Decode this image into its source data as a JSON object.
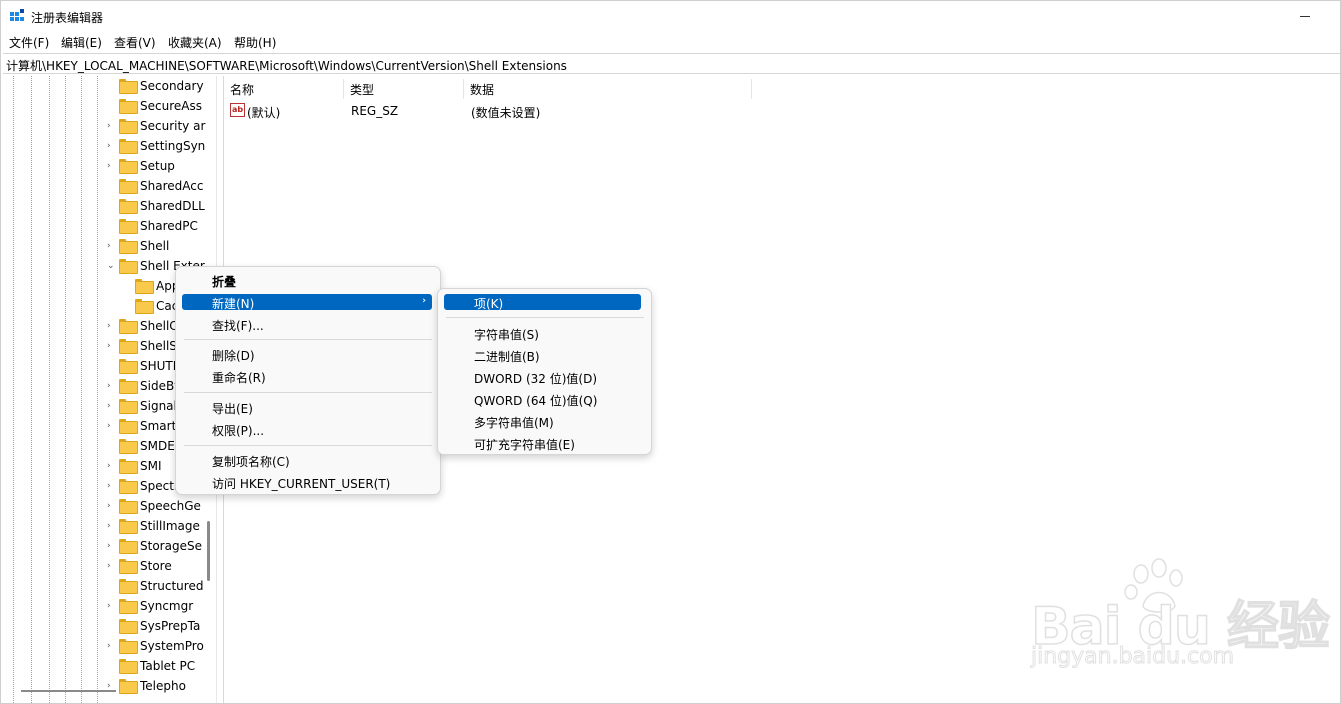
{
  "window": {
    "title": "注册表编辑器"
  },
  "menubar": [
    "文件(F)",
    "编辑(E)",
    "查看(V)",
    "收藏夹(A)",
    "帮助(H)"
  ],
  "address": "计算机\\HKEY_LOCAL_MACHINE\\SOFTWARE\\Microsoft\\Windows\\CurrentVersion\\Shell Extensions",
  "tree": {
    "items": [
      {
        "label": "Secondary",
        "expand": ""
      },
      {
        "label": "SecureAss",
        "expand": ""
      },
      {
        "label": "Security ar",
        "expand": "›"
      },
      {
        "label": "SettingSyn",
        "expand": "›"
      },
      {
        "label": "Setup",
        "expand": "›"
      },
      {
        "label": "SharedAcc",
        "expand": ""
      },
      {
        "label": "SharedDLL",
        "expand": ""
      },
      {
        "label": "SharedPC",
        "expand": ""
      },
      {
        "label": "Shell",
        "expand": "›"
      },
      {
        "label": "Shell Exter",
        "expand": "⌄"
      },
      {
        "label": "App",
        "expand": ""
      },
      {
        "label": "Cac",
        "expand": ""
      },
      {
        "label": "ShellC",
        "expand": "›"
      },
      {
        "label": "ShellS",
        "expand": "›"
      },
      {
        "label": "SHUTI",
        "expand": ""
      },
      {
        "label": "SideBy",
        "expand": "›"
      },
      {
        "label": "Signal",
        "expand": "›"
      },
      {
        "label": "Smart",
        "expand": "›"
      },
      {
        "label": "SMDE",
        "expand": ""
      },
      {
        "label": "SMI",
        "expand": "›"
      },
      {
        "label": "Spectr",
        "expand": "›"
      },
      {
        "label": "SpeechGe",
        "expand": "›"
      },
      {
        "label": "StillImage",
        "expand": "›"
      },
      {
        "label": "StorageSe",
        "expand": "›"
      },
      {
        "label": "Store",
        "expand": "›"
      },
      {
        "label": "Structured",
        "expand": ""
      },
      {
        "label": "Syncmgr",
        "expand": "›"
      },
      {
        "label": "SysPrepTa",
        "expand": ""
      },
      {
        "label": "SystemPro",
        "expand": "›"
      },
      {
        "label": "Tablet PC",
        "expand": ""
      },
      {
        "label": "Telepho",
        "expand": "›"
      }
    ]
  },
  "list": {
    "columns": [
      "名称",
      "类型",
      "数据"
    ],
    "rows": [
      {
        "icon": "ab",
        "name": "(默认)",
        "type": "REG_SZ",
        "data": "(数值未设置)"
      }
    ]
  },
  "context_menu": {
    "items": [
      "折叠",
      "新建(N)",
      "查找(F)...",
      "删除(D)",
      "重命名(R)",
      "导出(E)",
      "权限(P)...",
      "复制项名称(C)",
      "访问 HKEY_CURRENT_USER(T)"
    ],
    "submenu_arrow": "›"
  },
  "submenu": {
    "items": [
      "项(K)",
      "字符串值(S)",
      "二进制值(B)",
      "DWORD (32 位)值(D)",
      "QWORD (64 位)值(Q)",
      "多字符串值(M)",
      "可扩充字符串值(E)"
    ]
  },
  "watermark": {
    "logo": "Bai du 经验",
    "url": "jingyan.baidu.com"
  },
  "colors": {
    "highlight": "#0067c0",
    "folder": "#f8c94a"
  }
}
